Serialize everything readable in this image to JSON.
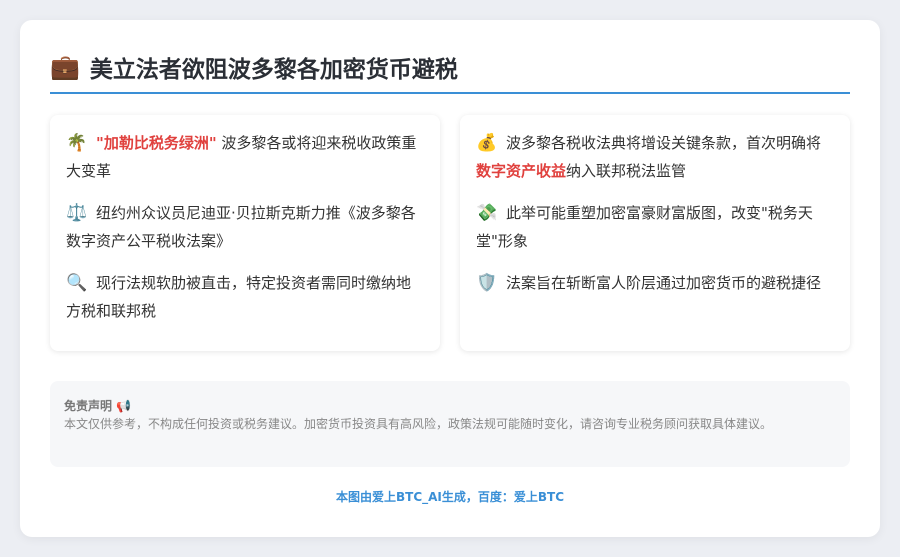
{
  "header": {
    "icon": "briefcase-icon",
    "title": "美立法者欲阻波多黎各加密货币避税"
  },
  "left": {
    "items": [
      {
        "icon": "palm-tree-icon",
        "glyph": "🌴",
        "highlight": "\"加勒比税务绿洲\"",
        "text": " 波多黎各或将迎来税收政策重大变革"
      },
      {
        "icon": "scales-icon",
        "glyph": "⚖️",
        "text": "纽约州众议员尼迪亚·贝拉斯克斯力推《波多黎各数字资产公平税收法案》"
      },
      {
        "icon": "magnifier-icon",
        "glyph": "🔍",
        "text": "现行法规软肋被直击，特定投资者需同时缴纳地方税和联邦税"
      }
    ]
  },
  "right": {
    "items": [
      {
        "icon": "money-bag-icon",
        "glyph": "💰",
        "pre": "波多黎各税收法典将增设关键条款，首次明确将",
        "highlight": "数字资产收益",
        "post": "纳入联邦税法监管"
      },
      {
        "icon": "money-wings-icon",
        "glyph": "💸",
        "text": "此举可能重塑加密富豪财富版图，改变\"税务天堂\"形象"
      },
      {
        "icon": "shield-icon",
        "glyph": "🛡️",
        "text": "法案旨在斩断富人阶层通过加密货币的避税捷径"
      }
    ]
  },
  "disclaimer": {
    "title": "免责声明 📢",
    "text": "本文仅供参考，不构成任何投资或税务建议。加密货币投资具有高风险，政策法规可能随时变化，请咨询专业税务顾问获取具体建议。"
  },
  "footer": {
    "text": "本图由爱上BTC_AI生成，百度：爱上BTC"
  },
  "colors": {
    "accent": "#3a8fd6",
    "highlight": "#e0413e"
  }
}
